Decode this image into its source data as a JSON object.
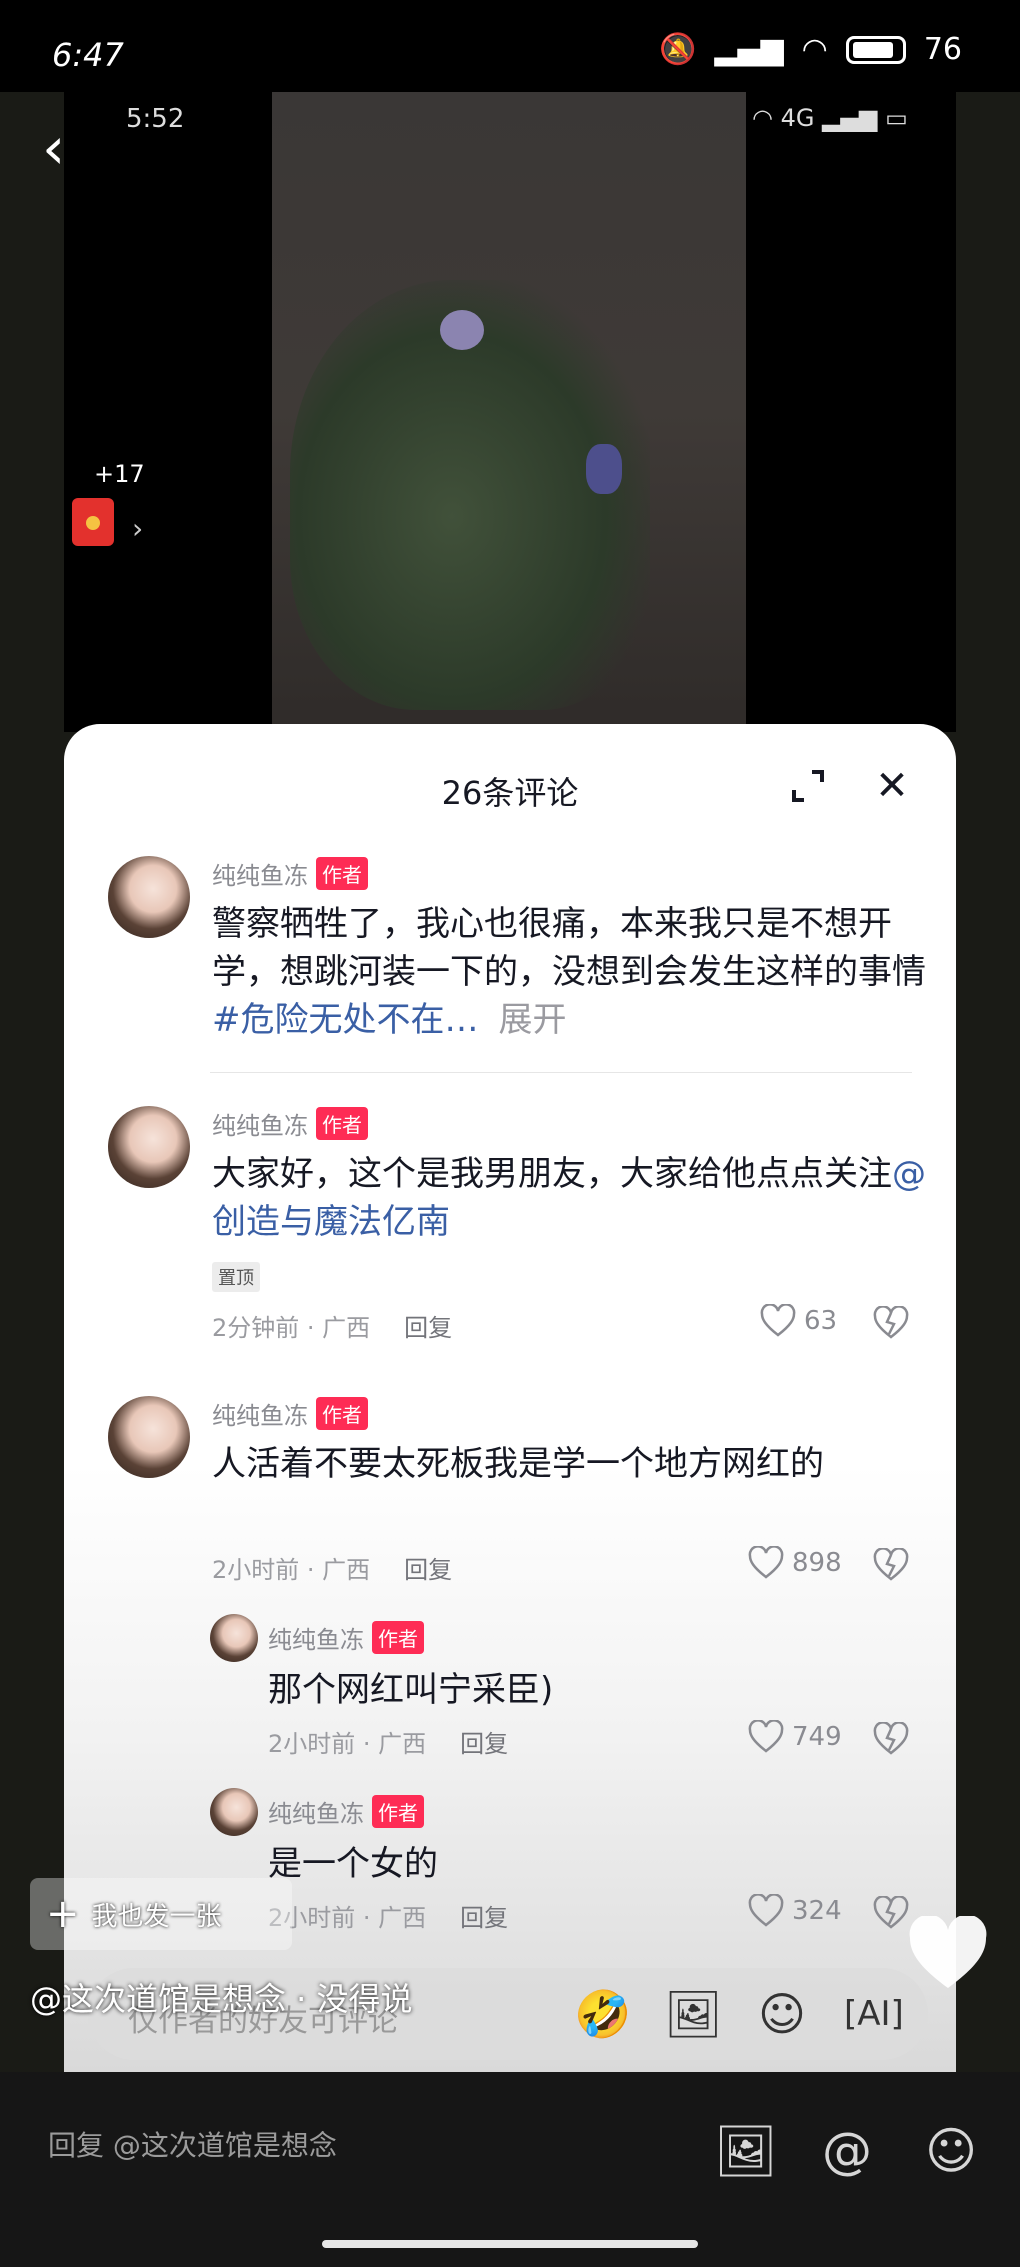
{
  "status_bar": {
    "time": "6:47",
    "battery": "76"
  },
  "video": {
    "time": "5:52",
    "network": "4G",
    "redpack_count": "+17"
  },
  "sheet": {
    "title": "26条评论"
  },
  "comments": [
    {
      "user": "纯纯鱼冻",
      "badge": "作者",
      "text_main": "警察牺牲了，我心也很痛，本来我只是不想开学，想跳河装一下的，没想到会发生这样的事情",
      "tag": "#危险无处不在…",
      "expand": "展开"
    },
    {
      "user": "纯纯鱼冻",
      "badge": "作者",
      "text_main": "大家好，这个是我男朋友，大家给他点点关注",
      "mention": "@创造与魔法亿南",
      "pin": "置顶",
      "meta": "2分钟前 · 广西",
      "reply": "回复",
      "likes": "63"
    },
    {
      "user": "纯纯鱼冻",
      "badge": "作者",
      "text_main": "人活着不要太死板我是学一个地方网红的",
      "meta": "2小时前 · 广西",
      "reply": "回复",
      "likes": "898"
    },
    {
      "user": "纯纯鱼冻",
      "badge": "作者",
      "text_main": "那个网红叫宁采臣)",
      "meta": "2小时前 · 广西",
      "reply": "回复",
      "likes": "749"
    },
    {
      "user": "纯纯鱼冻",
      "badge": "作者",
      "text_main": "是一个女的",
      "meta": "2小时前 · 广西",
      "reply": "回复",
      "likes": "324"
    }
  ],
  "overlay": {
    "post_button": "我也发一张",
    "mention_text": "@这次道馆是想念 · 没得说",
    "input_placeholder": "仅作者的好友可评论"
  },
  "reply_bar": {
    "placeholder": "回复 @这次道馆是想念"
  },
  "icons": [
    "back-icon",
    "expand-icon",
    "close-icon",
    "heart-icon",
    "dislike-icon",
    "image-icon",
    "emoji-icon",
    "ai-icon",
    "at-icon"
  ]
}
